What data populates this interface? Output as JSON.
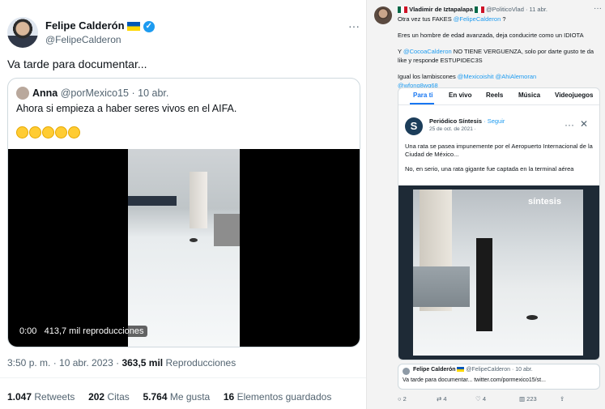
{
  "left_tweet": {
    "author_name": "Felipe Calderón",
    "author_handle": "@FelipeCalderon",
    "more": "···",
    "text": "Va tarde para documentar...",
    "quoted": {
      "author_name": "Anna",
      "author_handle": "@porMexico15",
      "date": "· 10 abr.",
      "text": "Ahora si empieza a haber seres vivos en el AIFA.",
      "video_time": "0:00",
      "video_views": "413,7 mil reproducciones"
    },
    "timestamp": "3:50 p. m. · 10 abr. 2023 ·",
    "views_count": "363,5 mil",
    "views_label": "Reproducciones",
    "stats": [
      {
        "count": "1.047",
        "label": "Retweets"
      },
      {
        "count": "202",
        "label": "Citas"
      },
      {
        "count": "5.764",
        "label": "Me gusta"
      },
      {
        "count": "16",
        "label": "Elementos guardados"
      }
    ]
  },
  "right_tweet": {
    "author_name": "Vladimir de Iztapalapa",
    "author_handle": "@PoliticoVlad",
    "date": "· 11 abr.",
    "more": "···",
    "line1_pre": "Otra vez tus FAKES ",
    "line1_mention": "@FelipeCalderon",
    "line1_post": " ?",
    "line2": "Eres un hombre de edad avanzada, deja conducirte como un IDIOTA",
    "line3_pre": "Y ",
    "line3_mention": "@CocoaCalderon",
    "line3_post": " NO TIENE VERGUENZA, solo por darte gusto te da like y responde ESTUPIDEC3S",
    "line4_pre": "Igual los lambiscones ",
    "line4_m1": "@Mexicoishit",
    "line4_m2": "@AhiAlemoran",
    "line4_m3": "@wfonq8wq68",
    "tabs": [
      "Para ti",
      "En vivo",
      "Reels",
      "Música",
      "Videojuegos"
    ],
    "fb_post": {
      "page_name": "Periódico Síntesis",
      "follow": "· Seguir",
      "date": "25 de oct. de 2021 ·",
      "text1": "Una rata se pasea impunemente por el Aeropuerto Internacional de la Ciudad de México...",
      "text2": "No, en serio, una rata gigante fue captada en la terminal aérea",
      "watermark": "síntesis"
    },
    "quote": {
      "author_name": "Felipe Calderón",
      "author_handle": "@FelipeCalderon",
      "date": "· 10 abr.",
      "text": "Va tarde para documentar... twitter.com/pormexico15/st..."
    },
    "actions": [
      {
        "icon": "reply-icon",
        "count": "2"
      },
      {
        "icon": "retweet-icon",
        "count": "4"
      },
      {
        "icon": "like-icon",
        "count": "4"
      },
      {
        "icon": "views-icon",
        "count": "223"
      }
    ]
  }
}
